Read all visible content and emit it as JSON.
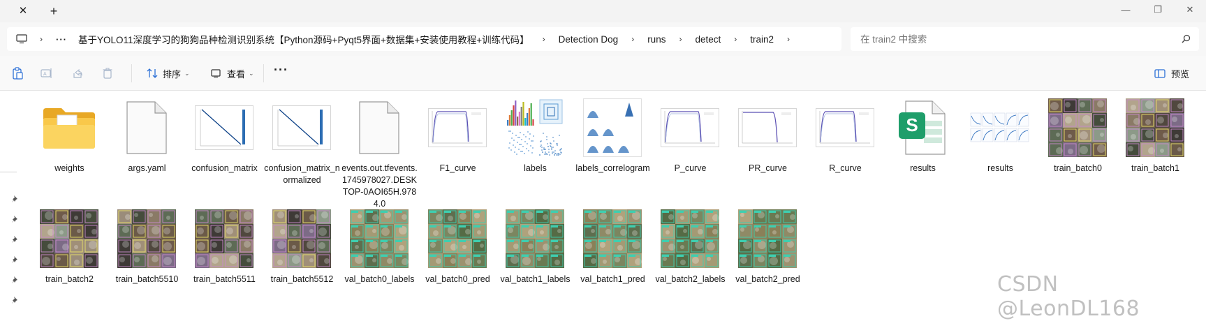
{
  "tabbar": {
    "close_glyph": "✕",
    "add_glyph": "+"
  },
  "window_controls": {
    "minimize": "—",
    "maximize": "❐",
    "close": "✕"
  },
  "address": {
    "more": "···",
    "crumbs": [
      "基于YOLO11深度学习的狗狗品种检测识别系统【Python源码+Pyqt5界面+数据集+安装使用教程+训练代码】",
      "Detection Dog",
      "runs",
      "detect",
      "train2"
    ],
    "sep": "›"
  },
  "search": {
    "placeholder": "在 train2 中搜索"
  },
  "toolbar": {
    "sort_label": "排序",
    "view_label": "查看",
    "more_label": "···",
    "preview_label": "预览"
  },
  "files": [
    {
      "name": "weights",
      "kind": "folder"
    },
    {
      "name": "args.yaml",
      "kind": "file"
    },
    {
      "name": "confusion_matrix",
      "kind": "matrix"
    },
    {
      "name": "confusion_matrix_normalized",
      "kind": "matrix"
    },
    {
      "name": "events.out.tfevents.1745978027.DESKTOP-0AOI65H.9784.0",
      "kind": "file"
    },
    {
      "name": "F1_curve",
      "kind": "curve"
    },
    {
      "name": "labels",
      "kind": "labels"
    },
    {
      "name": "labels_correlogram",
      "kind": "correlogram"
    },
    {
      "name": "P_curve",
      "kind": "curve"
    },
    {
      "name": "PR_curve",
      "kind": "curve2"
    },
    {
      "name": "R_curve",
      "kind": "curve"
    },
    {
      "name": "results",
      "kind": "sheet"
    },
    {
      "name": "results",
      "kind": "results"
    },
    {
      "name": "train_batch0",
      "kind": "batch"
    },
    {
      "name": "train_batch1",
      "kind": "batch"
    },
    {
      "name": "train_batch2",
      "kind": "batch"
    },
    {
      "name": "train_batch5510",
      "kind": "batch"
    },
    {
      "name": "train_batch5511",
      "kind": "batch"
    },
    {
      "name": "train_batch5512",
      "kind": "batch"
    },
    {
      "name": "val_batch0_labels",
      "kind": "valbatch"
    },
    {
      "name": "val_batch0_pred",
      "kind": "valbatch"
    },
    {
      "name": "val_batch1_labels",
      "kind": "valbatch"
    },
    {
      "name": "val_batch1_pred",
      "kind": "valbatch"
    },
    {
      "name": "val_batch2_labels",
      "kind": "valbatch"
    },
    {
      "name": "val_batch2_pred",
      "kind": "valbatch"
    }
  ],
  "colors": {
    "folder": "#f6c343",
    "sheet": "#1e9e6a",
    "accent": "#2b6fd6"
  },
  "watermark": "CSDN @LeonDL168"
}
